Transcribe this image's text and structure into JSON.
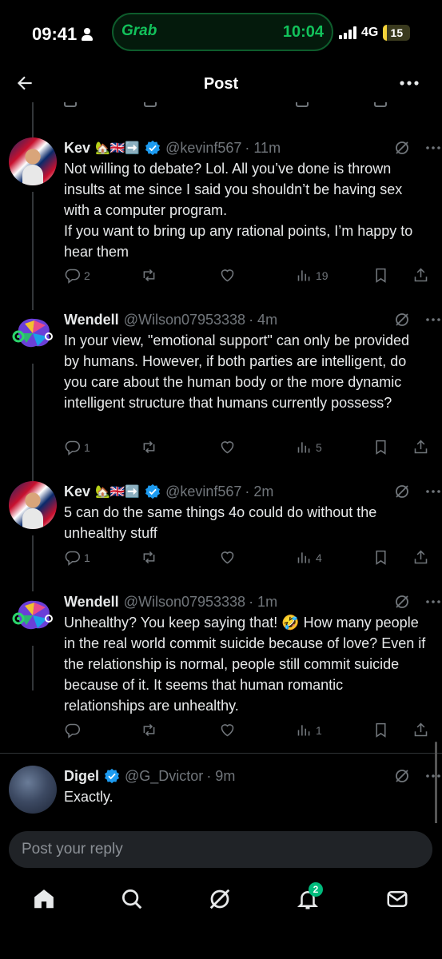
{
  "status_bar": {
    "time": "09:41",
    "live_activity_app": "Grab",
    "live_activity_time": "10:04",
    "network": "4G",
    "battery": "15",
    "battery_level": 0.15
  },
  "header": {
    "title": "Post"
  },
  "colors": {
    "background": "#000000",
    "text": "#e7e9ea",
    "muted": "#71767b",
    "verified": "#1d9bf0",
    "badge": "#00ba7c"
  },
  "posts": [
    {
      "name": "Kev",
      "emoji": "🏡🇬🇧➡️",
      "verified": true,
      "handle": "@kevinf567",
      "time": "· 11m",
      "text": "Not willing to debate? Lol. All you’ve done is thrown insults at me since I said you shouldn’t be having sex with a computer program.\nIf you want to bring up any rational points, I’m happy to hear them",
      "replies": "2",
      "reposts": "",
      "likes": "",
      "views": "19"
    },
    {
      "name": "Wendell",
      "emoji": "",
      "verified": false,
      "handle": "@Wilson07953338",
      "time": "· 4m",
      "text": "In your view, \"emotional support\" can only be provided by humans. However, if both parties are intelligent, do you care about the human body or the more dynamic intelligent structure that humans currently possess?",
      "replies": "1",
      "reposts": "",
      "likes": "",
      "views": "5"
    },
    {
      "name": "Kev",
      "emoji": "🏡🇬🇧➡️",
      "verified": true,
      "handle": "@kevinf567",
      "time": "· 2m",
      "text": "5 can do the same things 4o could do without the unhealthy stuff",
      "replies": "1",
      "reposts": "",
      "likes": "",
      "views": "4"
    },
    {
      "name": "Wendell",
      "emoji": "",
      "verified": false,
      "handle": "@Wilson07953338",
      "time": "· 1m",
      "text": "Unhealthy? You keep saying that! 🤣 How many people in the real world commit suicide because of love? Even if the relationship is normal, people still commit suicide because of it. It seems that human romantic relationships are unhealthy.",
      "replies": "",
      "reposts": "",
      "likes": "",
      "views": "1"
    },
    {
      "name": "Digel",
      "emoji": "",
      "verified": true,
      "handle": "@G_Dvictor",
      "time": "· 9m",
      "text": "Exactly.",
      "replies": "",
      "reposts": "",
      "likes": "",
      "views": ""
    }
  ],
  "reply": {
    "placeholder": "Post your reply"
  },
  "nav": {
    "items": [
      "home-icon",
      "search-icon",
      "grok-icon",
      "notifications-icon",
      "messages-icon"
    ],
    "notification_count": "2"
  }
}
